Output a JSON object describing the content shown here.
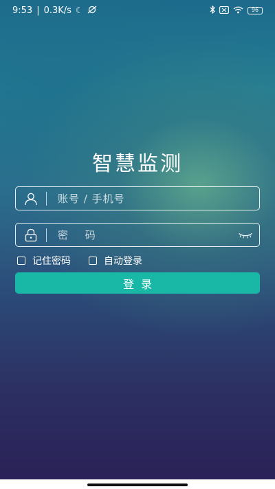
{
  "status_bar": {
    "time": "9:53",
    "separator": "|",
    "network_speed": "0.3K/s",
    "moon_icon": "moon-icon",
    "sync_off_icon": "sync-off-icon",
    "bluetooth_icon": "bluetooth-icon",
    "sim_icon": "sim-off-icon",
    "wifi_icon": "wifi-icon",
    "battery": "96"
  },
  "login": {
    "title": "智慧监测",
    "account_placeholder": "账号 / 手机号",
    "account_value": "",
    "password_placeholder": "密 码",
    "password_value": "",
    "remember_label": "记住密码",
    "auto_login_label": "自动登录",
    "submit_label": "登录"
  },
  "colors": {
    "primary_button": "#19b8a6",
    "text": "#ffffff"
  }
}
